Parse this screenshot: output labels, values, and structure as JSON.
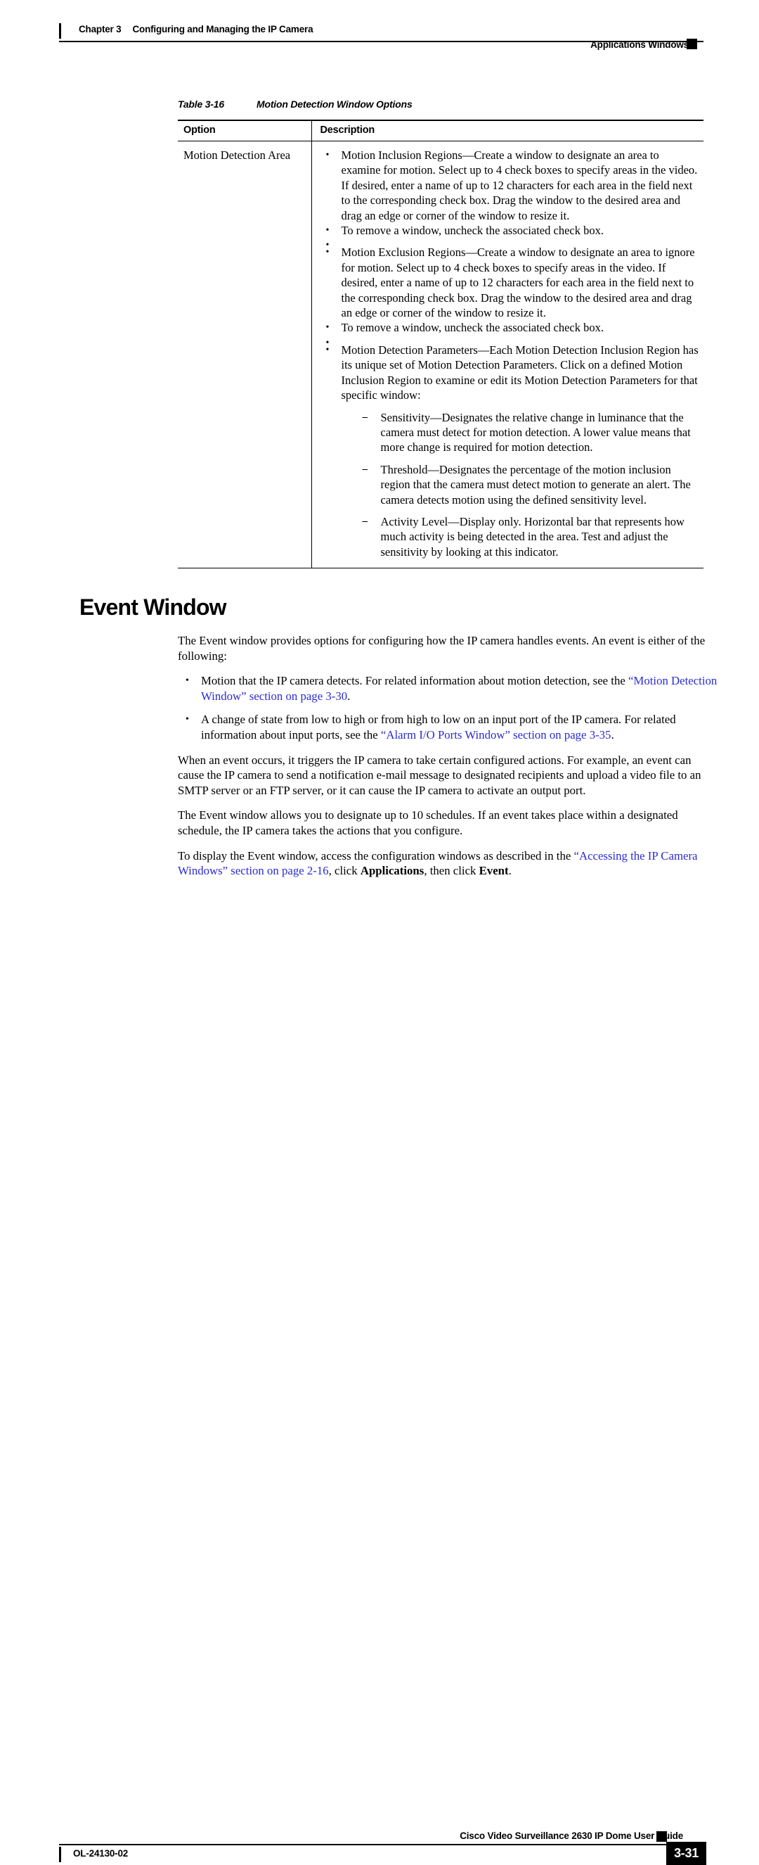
{
  "header": {
    "chapter_number": "Chapter 3",
    "chapter_title": "Configuring and Managing the IP Camera",
    "section_right": "Applications Windows"
  },
  "table": {
    "caption_number": "Table 3-16",
    "caption_title": "Motion Detection Window Options",
    "columns": [
      "Option",
      "Description"
    ],
    "row": {
      "option": "Motion Detection Area",
      "bullets": [
        {
          "text": "Motion Inclusion Regions—Create a window to designate an area to examine for motion. Select up to 4 check boxes to specify areas in the video. If desired, enter a name of up to 12 characters for each area in the field next to the corresponding check box. Drag the window to the desired area and drag an edge or corner of the window to resize it.",
          "note": "To remove a window, uncheck the associated check box."
        },
        {
          "text": "Motion Exclusion Regions—Create a window to designate an area to ignore for motion. Select up to 4 check boxes to specify areas in the video. If desired, enter a name of up to 12 characters for each area in the field next to the corresponding check box. Drag the window to the desired area and drag an edge or corner of the window to resize it.",
          "note": "To remove a window, uncheck the associated check box."
        },
        {
          "text": "Motion Detection Parameters—Each Motion Detection Inclusion Region has its unique set of Motion Detection Parameters. Click on a defined Motion Inclusion Region to examine or edit its Motion Detection Parameters for that specific window:",
          "subitems": [
            "Sensitivity—Designates the relative change in luminance that the camera must detect for motion detection. A lower value means that more change is required for motion detection.",
            "Threshold—Designates the percentage of the motion inclusion region that the camera must detect motion to generate an alert. The camera detects motion using the defined sensitivity level.",
            "Activity Level—Display only. Horizontal bar that represents how much activity is being detected in the area. Test and adjust the sensitivity by looking at this indicator."
          ]
        }
      ]
    }
  },
  "section": {
    "heading": "Event Window",
    "intro": "The Event window provides options for configuring how the IP camera handles events. An event is either of the following:",
    "bullets": [
      {
        "pre": "Motion that the IP camera detects. For related information about motion detection, see the ",
        "link": "“Motion Detection Window” section on page 3-30",
        "post": "."
      },
      {
        "pre": "A change of state from low to high or from high to low on an input port of the IP camera. For related information about input ports, see the ",
        "link": "“Alarm I/O Ports Window” section on page 3-35",
        "post": "."
      }
    ],
    "paragraph_actions": "When an event occurs, it triggers the IP camera to take certain configured actions. For example, an event can cause the IP camera to send a notification e-mail message to designated recipients and upload a video file to an SMTP server or an FTP server, or it can cause the IP camera to activate an output port.",
    "paragraph_schedules": "The Event window allows you to designate up to 10 schedules. If an event takes place within a designated schedule, the IP camera takes the actions that you configure.",
    "paragraph_display": {
      "pre": "To display the Event window, access the configuration windows as described in the ",
      "link": "“Accessing the IP Camera Windows” section on page 2-16",
      "mid": ", click ",
      "bold1": "Applications",
      "mid2": ", then click ",
      "bold2": "Event",
      "post": "."
    },
    "link_color": "#2b2bd4"
  },
  "footer": {
    "guide_title": "Cisco Video Surveillance 2630 IP Dome User Guide",
    "doc_id": "OL-24130-02",
    "page_number": "3-31"
  }
}
